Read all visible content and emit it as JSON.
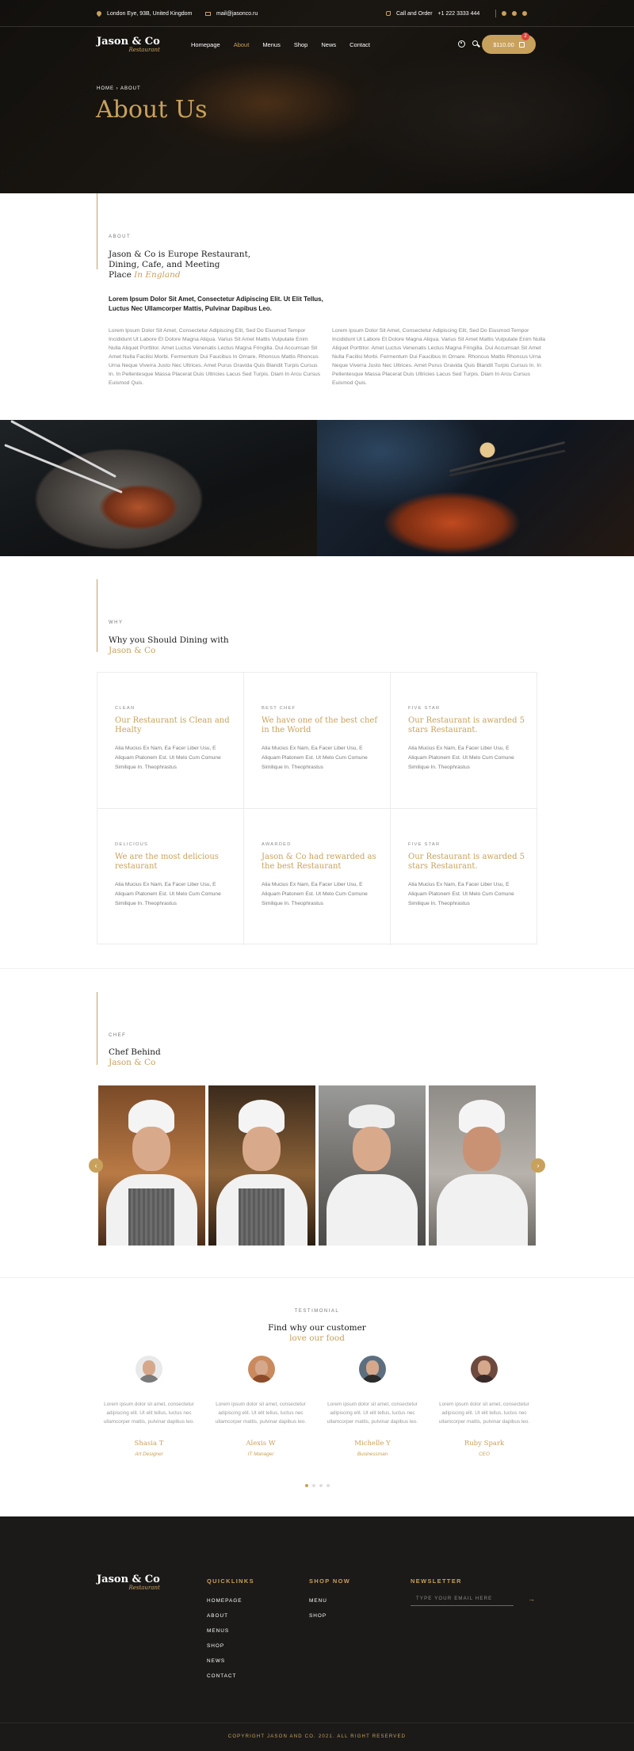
{
  "topbar": {
    "address": "London Eye, 93B, United Kingdom",
    "email": "mail@jasonco.ru",
    "call_label": "Call and Order",
    "phone": "+1 222 3333 444"
  },
  "brand": {
    "name": "Jason & Co",
    "sub": "Restaurant"
  },
  "nav": {
    "items": [
      "Homepage",
      "About",
      "Menus",
      "Shop",
      "News",
      "Contact"
    ],
    "active": "About"
  },
  "cart": {
    "total": "$110.00",
    "count": "2"
  },
  "hero": {
    "crumb_home": "HOME",
    "crumb_sep": "›",
    "crumb_current": "ABOUT",
    "title": "About Us"
  },
  "about": {
    "kicker": "ABOUT",
    "title_line1": "Jason & Co is Europe Restaurant,",
    "title_line2": "Dining, Cafe, and Meeting",
    "title_line3": "Place",
    "title_accent": "In England",
    "lead": "Lorem Ipsum Dolor Sit Amet, Consectetur Adipiscing Elit. Ut Elit Tellus, Luctus Nec Ullamcorper Mattis, Pulvinar Dapibus Leo.",
    "col1": "Lorem Ipsum Dolor Sit Amet, Consectetur Adipiscing Elit, Sed Do Eiusmod Tempor Incididunt Ut Labore Et Dolore Magna Aliqua. Varius Sit Amet Mattis Vulputate Enim Nulla Aliquet Porttitor. Amet Luctus Venenatis Lectus Magna Fringilla. Dui Accumsan Sit Amet Nulla Facilisi Morbi. Fermentum Dui Faucibus In Ornare. Rhoncus Mattis Rhoncus Urna Neque Viverra Justo Nec Ultrices. Amet Purus Gravida Quis Blandit Turpis Cursus In. In Pellentesque Massa Placerat Duis Ultricies Lacus Sed Turpis. Diam In Arcu Cursus Euismod Quis.",
    "col2": "Lorem Ipsum Dolor Sit Amet, Consectetur Adipiscing Elit, Sed Do Eiusmod Tempor Incididunt Ut Labore Et Dolore Magna Aliqua. Varius Sit Amet Mattis Vulputate Enim Nulla Aliquet Porttitor. Amet Luctus Venenatis Lectus Magna Fringilla. Dui Accumsan Sit Amet Nulla Facilisi Morbi. Fermentum Dui Faucibus In Ornare. Rhoncus Mattis Rhoncus Urna Neque Viverra Justo Nec Ultrices. Amet Purus Gravida Quis Blandit Turpis Cursus In. In Pellentesque Massa Placerat Duis Ultricies Lacus Sed Turpis. Diam In Arcu Cursus Euismod Quis."
  },
  "why": {
    "kicker": "WHY",
    "title": "Why you Should Dining with",
    "title_accent": "Jason & Co",
    "cards": [
      {
        "kicker": "CLEAN",
        "title": "Our Restaurant is Clean and Healty",
        "desc": "Alia Mucius Ex Nam, Ea Facer Liber Usu, E Aliquam Platonem Est. Ut Melo Cum Comune Similique In. Theophrastus"
      },
      {
        "kicker": "BEST CHEF",
        "title": "We have one of the best chef in the World",
        "desc": "Alia Mucius Ex Nam, Ea Facer Liber Usu, E Aliquam Platonem Est. Ut Melo Cum Comune Similique In. Theophrastus"
      },
      {
        "kicker": "FIVE STAR",
        "title": "Our Restaurant is awarded 5 stars Restaurant.",
        "desc": "Alia Mucius Ex Nam, Ea Facer Liber Usu, E Aliquam Platonem Est. Ut Melo Cum Comune Similique In. Theophrastus"
      },
      {
        "kicker": "DELICIOUS",
        "title": "We are the most delicious restaurant",
        "desc": "Alia Mucius Ex Nam, Ea Facer Liber Usu, E Aliquam Platonem Est. Ut Melo Cum Comune Similique In. Theophrastus"
      },
      {
        "kicker": "AWARDED",
        "title": "Jason & Co had rewarded as the best Restaurant",
        "desc": "Alia Mucius Ex Nam, Ea Facer Liber Usu, E Aliquam Platonem Est. Ut Melo Cum Comune Similique In. Theophrastus"
      },
      {
        "kicker": "FIVE STAR",
        "title": "Our Restaurant is awarded 5 stars Restaurant.",
        "desc": "Alia Mucius Ex Nam, Ea Facer Liber Usu, E Aliquam Platonem Est. Ut Melo Cum Comune Similique In. Theophrastus"
      }
    ]
  },
  "chefs": {
    "kicker": "CHEF",
    "title": "Chef Behind",
    "title_accent": "Jason & Co",
    "prev": "‹",
    "next": "›"
  },
  "testimonial": {
    "kicker": "TESTIMONIAL",
    "title": "Find why our customer",
    "title_accent": "love our food",
    "items": [
      {
        "quote": "Lorem ipsum dolor sit amet, consectetur adipiscing elit. Ut elit tellus, luctus nec ullamcorper mattis, pulvinar dapibus leo.",
        "name": "Shasia T",
        "role": "Art Designer"
      },
      {
        "quote": "Lorem ipsum dolor sit amet, consectetur adipiscing elit. Ut elit tellus, luctus nec ullamcorper mattis, pulvinar dapibus leo.",
        "name": "Alexis W",
        "role": "IT Manager"
      },
      {
        "quote": "Lorem ipsum dolor sit amet, consectetur adipiscing elit. Ut elit tellus, luctus nec ullamcorper mattis, pulvinar dapibus leo.",
        "name": "Michelle Y",
        "role": "Businessman"
      },
      {
        "quote": "Lorem ipsum dolor sit amet, consectetur adipiscing elit. Ut elit tellus, luctus nec ullamcorper mattis, pulvinar dapibus leo.",
        "name": "Ruby Spark",
        "role": "CEO"
      }
    ]
  },
  "footer": {
    "quicklinks_title": "QUICKLINKS",
    "quicklinks": [
      "HOMEPAGE",
      "ABOUT",
      "MENUS",
      "SHOP",
      "NEWS",
      "CONTACT"
    ],
    "shop_title": "SHOP NOW",
    "shop_links": [
      "MENU",
      "SHOP"
    ],
    "newsletter_title": "NEWSLETTER",
    "newsletter_placeholder": "TYPE YOUR EMAIL HERE",
    "send": "→",
    "copyright": "COPYRIGHT JASON AND CO. 2021. ALL RIGHT RESERVED"
  },
  "colors": {
    "accent": "#c8a15c",
    "dark": "#1b1a19",
    "text": "#1b1b1b"
  }
}
